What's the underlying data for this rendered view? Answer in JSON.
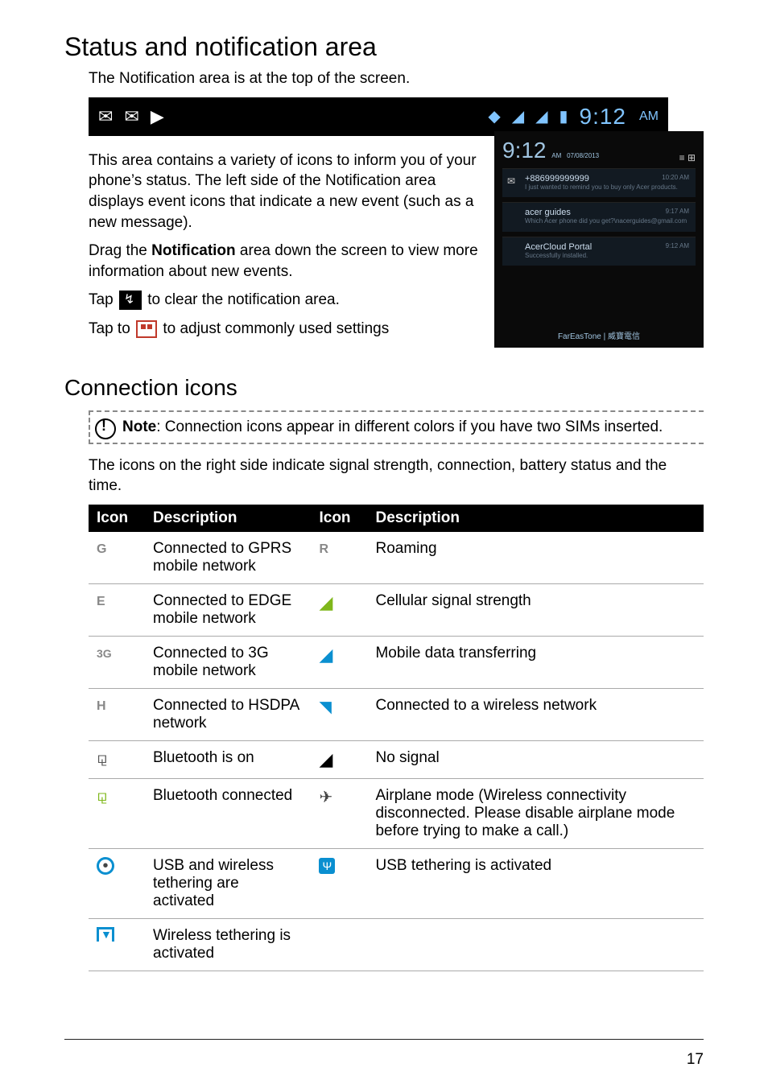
{
  "page": {
    "title": "Status and notification area",
    "intro": "The Notification area is at the top of the screen.",
    "status_bar": {
      "time": "9:12",
      "ampm": "AM"
    },
    "para1": "This area contains a variety of icons to inform you of your phone’s status. The left side of the Notification area displays event icons that indicate a new event (such as a new message).",
    "para2_pre": "Drag the ",
    "para2_bold": "Notification",
    "para2_post": " area down the screen to view more information about new events.",
    "tap_clear_pre": "Tap ",
    "tap_clear_post": " to clear the notification area.",
    "tap_settings_pre": "Tap to ",
    "tap_settings_post": " to adjust commonly used settings",
    "notif_panel": {
      "time": "9:12",
      "ampm": "AM",
      "date": "07/08/2013",
      "items": [
        {
          "title": "+886999999999",
          "sub": "I just wanted to remind you to buy only Acer products.",
          "ts": "10:20 AM"
        },
        {
          "title": "acer guides",
          "sub": "Which Acer phone did you get?\\nacerguides@gmail.com",
          "ts": "9:17 AM"
        },
        {
          "title": "AcerCloud Portal",
          "sub": "Successfully installed.",
          "ts": "9:12 AM"
        }
      ],
      "footer": "FarEasTone | 威寶電信"
    },
    "sub_title": "Connection icons",
    "note": "Note",
    "note_text": ": Connection icons appear in different colors if you have two SIMs inserted.",
    "para3": "The icons on the right side indicate signal strength, connection, battery status and the time.",
    "table": {
      "headers": [
        "Icon",
        "Description",
        "Icon",
        "Description"
      ],
      "rows": [
        {
          "i1": "G",
          "d1": "Connected to GPRS mobile network",
          "i2": "R",
          "d2": "Roaming"
        },
        {
          "i1": "E",
          "d1": "Connected to EDGE mobile network",
          "i2": "sig",
          "d2": "Cellular signal strength"
        },
        {
          "i1": "3G",
          "d1": "Connected to 3G mobile network",
          "i2": "sigx",
          "d2": "Mobile data transferring"
        },
        {
          "i1": "H",
          "d1": "Connected to HSDPA network",
          "i2": "wifi",
          "d2": "Connected to a wireless network"
        },
        {
          "i1": "bt",
          "d1": "Bluetooth is on",
          "i2": "nos",
          "d2": "No signal"
        },
        {
          "i1": "btc",
          "d1": "Bluetooth connected",
          "i2": "plane",
          "d2": "Airplane mode (Wireless connectivity disconnected. Please disable airplane mode before trying to make a call.)"
        },
        {
          "i1": "teth",
          "d1": "USB and wireless tethering are activated",
          "i2": "usb",
          "d2": "USB tethering is activated"
        },
        {
          "i1": "wteth",
          "d1": "Wireless tethering is activated",
          "i2": "",
          "d2": ""
        }
      ]
    },
    "page_number": "17"
  }
}
